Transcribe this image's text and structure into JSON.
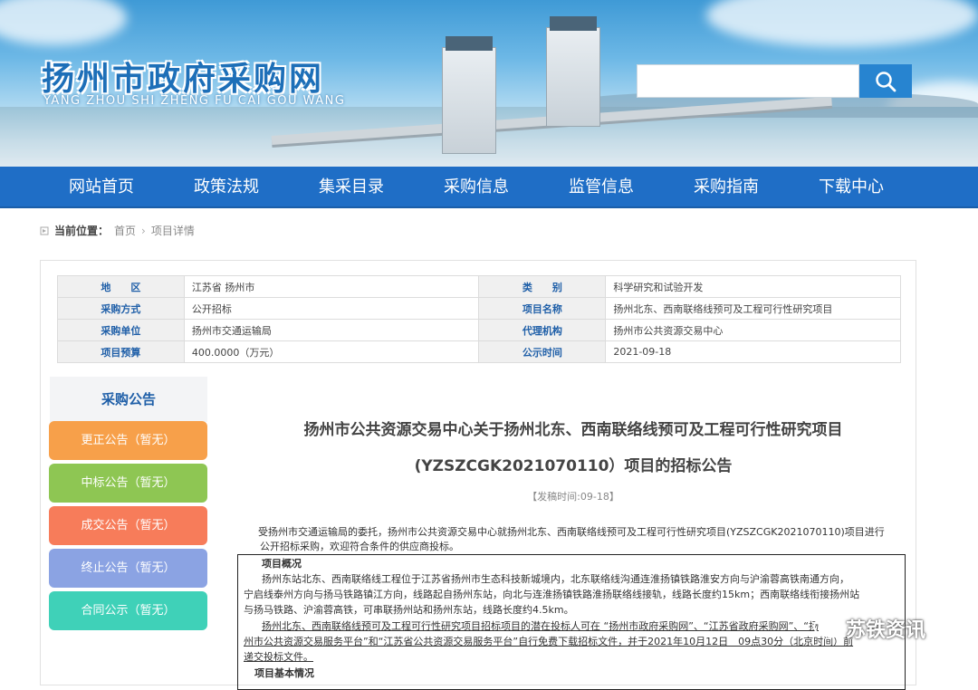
{
  "site": {
    "title": "扬州市政府采购网",
    "subtitle": "YANG ZHOU SHI ZHENG FU CAI GOU WANG",
    "search_placeholder": ""
  },
  "nav": [
    "网站首页",
    "政策法规",
    "集采目录",
    "采购信息",
    "监管信息",
    "采购指南",
    "下载中心"
  ],
  "breadcrumb": {
    "label": "当前位置：",
    "items": [
      "首页",
      "项目详情"
    ]
  },
  "info": {
    "rows": [
      {
        "k1": "地　　区",
        "v1": "江苏省 扬州市",
        "k2": "类　　别",
        "v2": "科学研究和试验开发"
      },
      {
        "k1": "采购方式",
        "v1": "公开招标",
        "k2": "项目名称",
        "v2": "扬州北东、西南联络线预可及工程可行性研究项目"
      },
      {
        "k1": "采购单位",
        "v1": "扬州市交通运输局",
        "k2": "代理机构",
        "v2": "扬州市公共资源交易中心"
      },
      {
        "k1": "项目预算",
        "v1": "400.0000（万元）",
        "k2": "公示时间",
        "v2": "2021-09-18"
      }
    ]
  },
  "sidebar": {
    "heading": "采购公告",
    "items": [
      {
        "label": "更正公告（暂无）",
        "color": "#f7a04a"
      },
      {
        "label": "中标公告（暂无）",
        "color": "#8ec653"
      },
      {
        "label": "成交公告（暂无）",
        "color": "#f77c5a"
      },
      {
        "label": "终止公告（暂无）",
        "color": "#8ba3e3"
      },
      {
        "label": "合同公示（暂无）",
        "color": "#3fd1b8"
      }
    ]
  },
  "article": {
    "title_line1": "扬州市公共资源交易中心关于扬州北东、西南联络线预可及工程可行性研究项目",
    "title_line2": "(YZSZCGK2021070110）项目的招标公告",
    "time": "【发稿时间:09-18】",
    "intro_line1": "受扬州市交通运输局的委托，扬州市公共资源交易中心就扬州北东、西南联络线预可及工程可行性研究项目(YZSZCGK2021070110)项目进行",
    "intro_line2": "公开招标采购，欢迎符合条件的供应商投标。",
    "section_title": "项目概况",
    "overview_lines": [
      "扬州东站北东、西南联络线工程位于江苏省扬州市生态科技新城境内，北东联络线沟通连淮扬镇铁路淮安方向与沪渝蓉高铁南通方向，",
      "宁启线泰州方向与扬马铁路镇江方向，线路起自扬州东站，向北与连淮扬镇铁路淮扬联络线接轨，线路长度约15km；西南联络线衔接扬州站",
      "与扬马铁路、沪渝蓉高铁，可串联扬州站和扬州东站，线路长度约4.5km。"
    ],
    "notice_lines": [
      "扬州北东、西南联络线预可及工程可行性研究项目招标项目的潜在投标人可在 “扬州市政府采购网”、“江苏省政府采购网”、“扬",
      "州市公共资源交易服务平台”和“江苏省公共资源交易服务平台”自行免费下载招标文件，并于2021年10月12日　09点30分（北京时间）前",
      "递交投标文件。"
    ],
    "cut_line": "项目基本情况"
  },
  "watermark": "苏铁资讯"
}
